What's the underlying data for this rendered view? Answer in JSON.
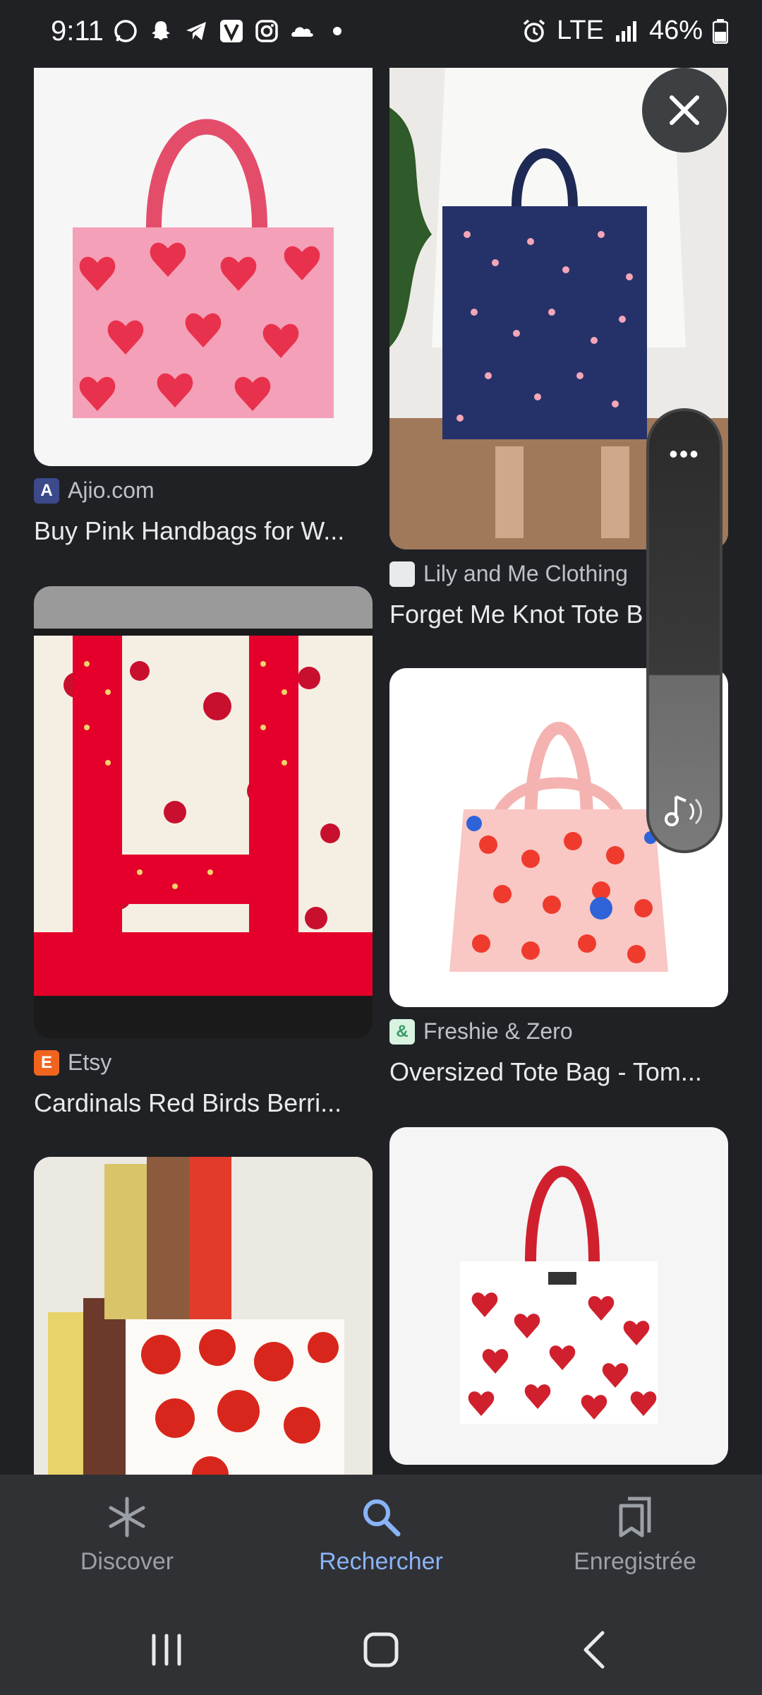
{
  "status_bar": {
    "time": "9:11",
    "left_icons": [
      "whatsapp-icon",
      "snapchat-icon",
      "telegram-icon",
      "v-app-icon",
      "instagram-icon",
      "cloud-app-icon",
      "dot-icon"
    ],
    "network": "LTE",
    "battery": "46%"
  },
  "results": [
    {
      "source": "Ajio.com",
      "title": "Buy Pink Handbags for W...",
      "favicon_color": "#3c4a8c",
      "favicon_text": "A"
    },
    {
      "source": "Lily and Me Clothing",
      "title": "Forget Me Knot Tote B",
      "favicon_color": "#e8eaed",
      "favicon_text": ""
    },
    {
      "source": "Etsy",
      "title": "Cardinals Red Birds Berri...",
      "favicon_color": "#f1641e",
      "favicon_text": "E"
    },
    {
      "source": "Freshie & Zero",
      "title": "Oversized Tote Bag - Tom...",
      "favicon_color": "#d8f3e0",
      "favicon_text": "&"
    }
  ],
  "overlay": {
    "dots": "•••"
  },
  "bottom_nav": {
    "items": [
      {
        "label": "Discover",
        "icon": "asterisk-icon"
      },
      {
        "label": "Rechercher",
        "icon": "search-icon",
        "active": true
      },
      {
        "label": "Enregistrée",
        "icon": "bookmarks-icon"
      }
    ]
  },
  "colors": {
    "background": "#202124",
    "accent": "#8ab4f8",
    "nav_bg": "#303134"
  }
}
